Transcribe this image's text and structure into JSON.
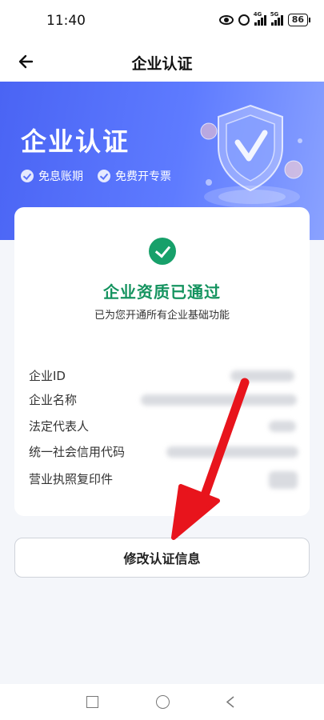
{
  "status_bar": {
    "time": "11:40",
    "battery": "86",
    "icons": [
      "eye-icon",
      "alarm-icon",
      "signal-4g-icon",
      "signal-5g-icon",
      "battery-icon"
    ],
    "network_tags": [
      "4G",
      "5G"
    ]
  },
  "header": {
    "title": "企业认证",
    "back_icon": "arrow-left-icon"
  },
  "banner": {
    "title": "企业认证",
    "benefits": [
      "免息账期",
      "免费开专票"
    ],
    "colors": {
      "start": "#4a64f4",
      "end": "#8aa2ff"
    }
  },
  "status_card": {
    "title": "企业资质已通过",
    "subtitle": "已为您开通所有企业基础功能",
    "accent": "#17a06a",
    "rows": [
      {
        "label": "企业ID"
      },
      {
        "label": "企业名称"
      },
      {
        "label": "法定代表人"
      },
      {
        "label": "统一社会信用代码"
      },
      {
        "label": "营业执照复印件"
      }
    ]
  },
  "actions": {
    "edit_label": "修改认证信息"
  },
  "annotation": {
    "arrow_color": "#e8141c"
  },
  "system_nav": {
    "icons": [
      "recent-apps-icon",
      "home-icon",
      "back-icon"
    ]
  }
}
